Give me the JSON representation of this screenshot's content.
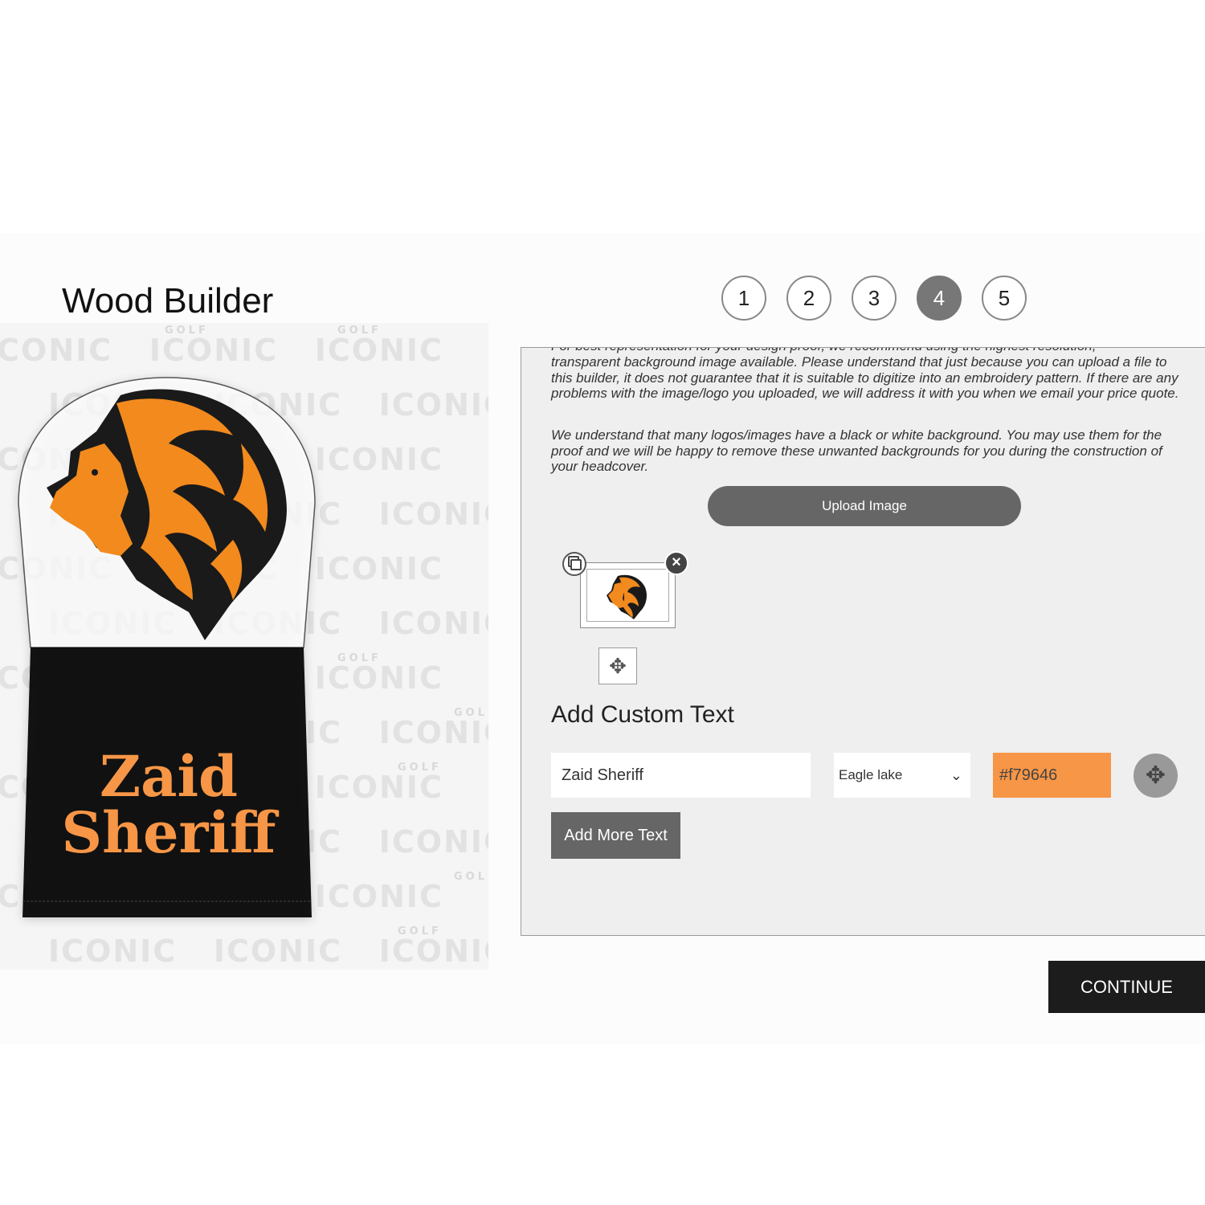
{
  "page": {
    "title": "Wood Builder"
  },
  "steps": [
    {
      "label": "1",
      "active": false
    },
    {
      "label": "2",
      "active": false
    },
    {
      "label": "3",
      "active": false
    },
    {
      "label": "4",
      "active": true
    },
    {
      "label": "5",
      "active": false
    }
  ],
  "preview": {
    "watermark_word": "ICONIC",
    "watermark_small": "GOLF",
    "text_line1": "Zaid",
    "text_line2": "Sheriff",
    "text_color": "#f79646",
    "cover_top_color": "#ffffff",
    "cover_bottom_color": "#000000",
    "logo": "lion-head-logo"
  },
  "panel": {
    "cut_line": "For best representation for your design proof, we recommend using the highest resolution,",
    "paragraph1": "transparent background image available. Please understand that just because you can upload a file to this builder, it does not guarantee that it is suitable to digitize into an embroidery pattern. If there are any problems with the image/logo you uploaded, we will address it with you when we email your price quote.",
    "paragraph2": "We understand that many logos/images have a black or white background. You may use them for the proof and we will be happy to remove these unwanted backgrounds for you during the construction of your headcover.",
    "upload_label": "Upload Image",
    "thumbnail": "lion-head-logo",
    "copy_icon": "copy-icon",
    "close_icon": "close-icon",
    "move_icon": "move-icon",
    "custom_text_heading": "Add Custom Text",
    "text_value": "Zaid Sheriff",
    "font_value": "Eagle lake",
    "color_value": "#f79646",
    "add_more_label": "Add More Text"
  },
  "continue_label": "CONTINUE",
  "colors": {
    "accent": "#f79646",
    "active_step": "#777777",
    "button": "#666666",
    "continue_bg": "#1c1c1c"
  }
}
